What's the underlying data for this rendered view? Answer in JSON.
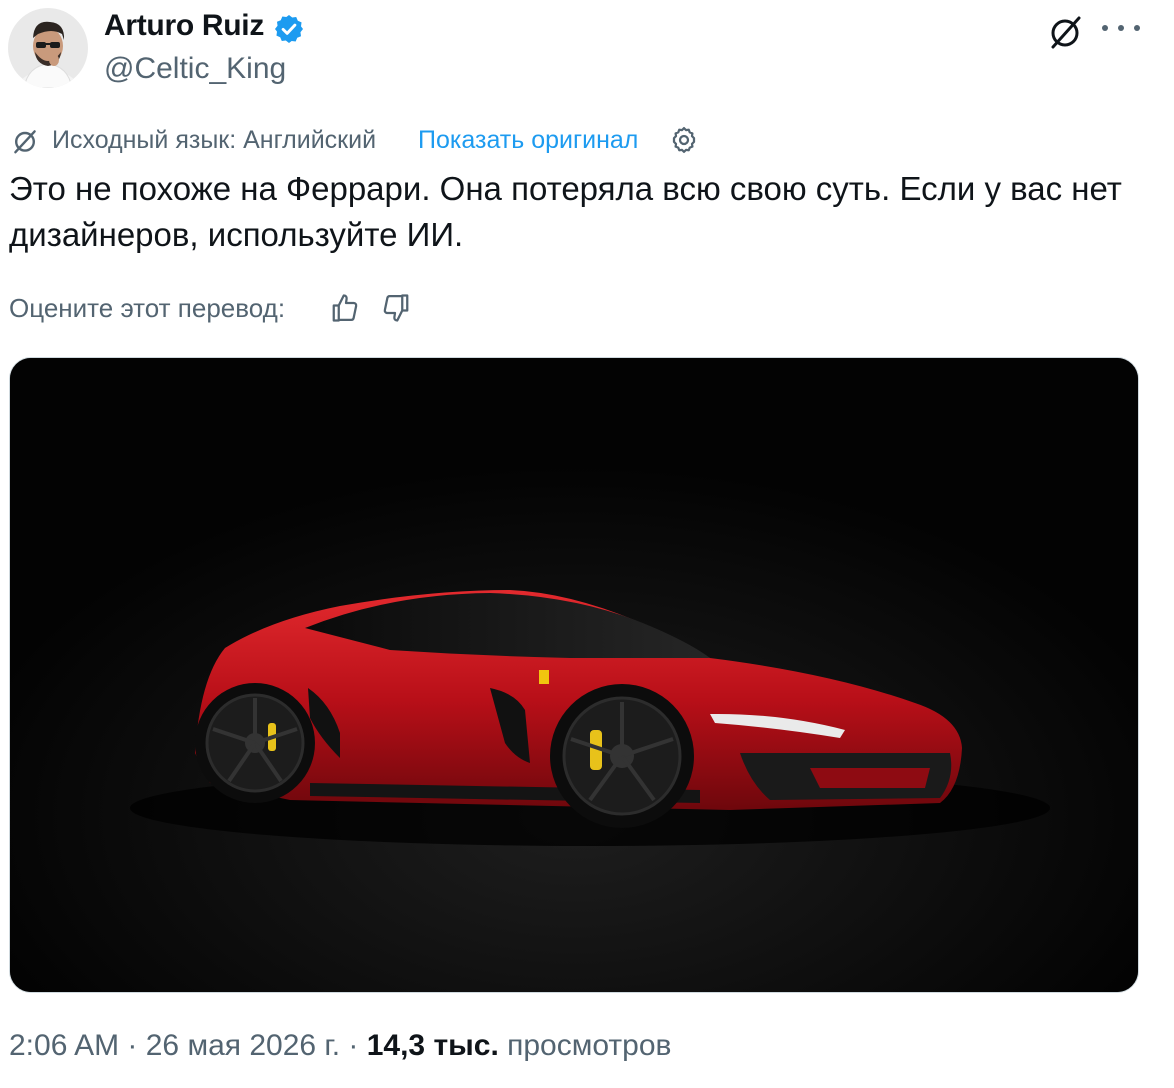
{
  "author": {
    "name": "Arturo Ruiz",
    "handle": "@Celtic_King",
    "verified": true
  },
  "icons": {
    "verified": "verified-badge-icon",
    "grok": "grok-icon",
    "more": "more-icon",
    "translate": "grok-translate-icon",
    "settings": "gear-icon",
    "like_translation": "thumbs-up-icon",
    "dislike_translation": "thumbs-down-icon"
  },
  "translation": {
    "source_label": "Исходный язык: Английский",
    "show_original": "Показать оригинал",
    "rate_label": "Оцените этот перевод:"
  },
  "tweet": {
    "text": "Это не похоже на Феррари. Она потеряла всю свою суть. Если у вас нет дизайнеров, используйте ИИ."
  },
  "meta": {
    "time": "2:06 AM",
    "separator": " · ",
    "date": "26 мая 2026 г.",
    "views_count": "14,3 тыс.",
    "views_label": "просмотров"
  },
  "colors": {
    "accent": "#1d9bf0",
    "secondary_text": "#536471",
    "primary_text": "#0f1419",
    "car_red": "#c8101b"
  }
}
